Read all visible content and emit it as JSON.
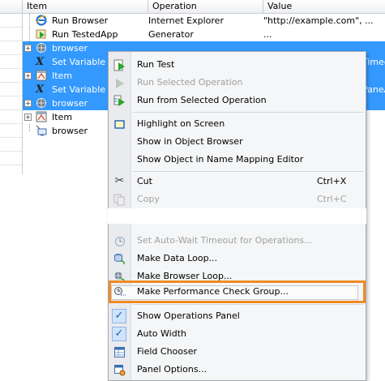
{
  "grid": {
    "headers": [
      "Item",
      "Operation",
      "Value"
    ],
    "rows": [
      {
        "item": "Run Browser",
        "operation": "Internet Explorer",
        "value": "\"http://example.com\", ...",
        "selected": false
      },
      {
        "item": "Run TestedApp",
        "operation": "Generator",
        "value": "...",
        "selected": false
      },
      {
        "item": "browser",
        "operation": "",
        "value": "",
        "selected": true
      },
      {
        "item": "Set Variable Va",
        "operation": "",
        "value": "",
        "tail": "Timeo",
        "selected": true
      },
      {
        "item": "Item",
        "operation": "",
        "value": "",
        "selected": true
      },
      {
        "item": "Set Variable Va",
        "operation": "",
        "value": "",
        "tail": "PaneA",
        "selected": true
      },
      {
        "item": "browser",
        "operation": "",
        "value": "",
        "selected": true
      },
      {
        "item": "Item",
        "operation": "",
        "value": "",
        "selected": false
      },
      {
        "item": "browser",
        "operation": "",
        "value": "",
        "selected": false
      }
    ]
  },
  "menu": {
    "run_test": "Run Test",
    "run_selected": "Run Selected Operation",
    "run_from_selected": "Run from Selected Operation",
    "highlight": "Highlight on Screen",
    "show_object_browser": "Show in Object Browser",
    "show_name_mapping": "Show Object in Name Mapping Editor",
    "cut": "Cut",
    "cut_shortcut": "Ctrl+X",
    "copy": "Copy",
    "copy_shortcut": "Ctrl+C",
    "set_auto_wait": "Set Auto-Wait Timeout for Operations...",
    "make_data_loop": "Make Data Loop...",
    "make_browser_loop": "Make Browser Loop...",
    "make_perf_check": "Make Performance Check Group...",
    "show_ops_panel": "Show Operations Panel",
    "auto_width": "Auto Width",
    "field_chooser": "Field Chooser",
    "panel_options": "Panel Options...",
    "accent_color": "#f08a24"
  }
}
